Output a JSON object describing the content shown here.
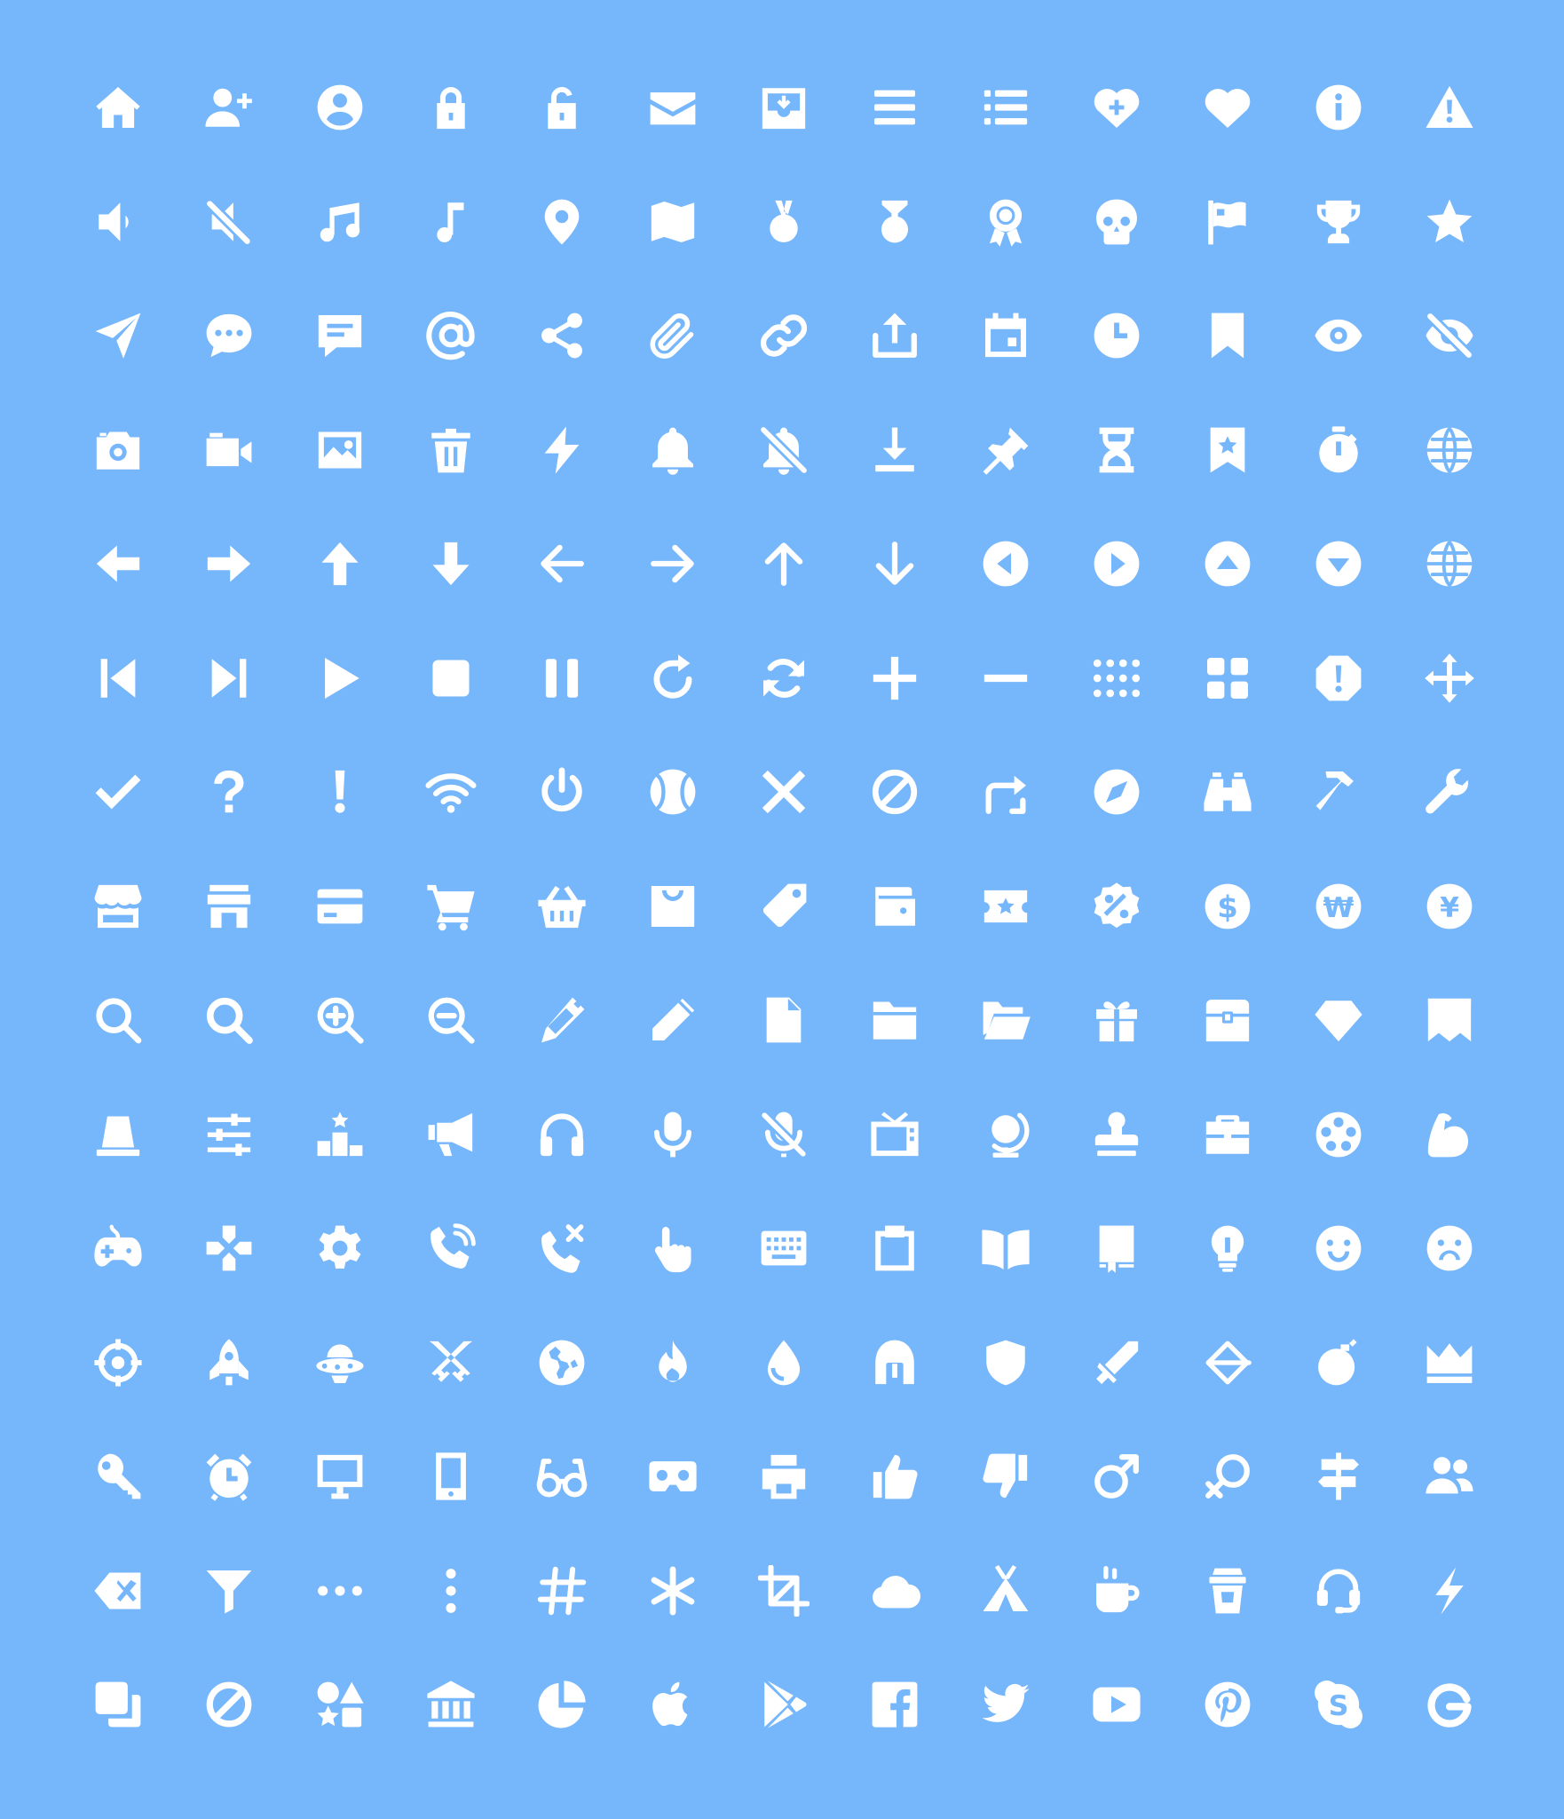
{
  "background": "#76b6fb",
  "icon_color": "#ffffff",
  "rows": [
    [
      "home-icon",
      "add-user-icon",
      "user-circle-icon",
      "lock-icon",
      "unlock-icon",
      "mail-icon",
      "inbox-icon",
      "menu-icon",
      "list-icon",
      "heart-plus-icon",
      "heart-icon",
      "info-icon",
      "warning-icon"
    ],
    [
      "volume-icon",
      "mute-icon",
      "music-notes-icon",
      "music-note-icon",
      "location-pin-icon",
      "map-icon",
      "medal-icon",
      "medal-ribbon-icon",
      "award-icon",
      "skull-icon",
      "flag-icon",
      "trophy-icon",
      "star-icon"
    ],
    [
      "send-icon",
      "chat-bubble-icon",
      "comment-icon",
      "at-icon",
      "share-icon",
      "paperclip-icon",
      "link-icon",
      "upload-icon",
      "calendar-icon",
      "clock-icon",
      "bookmark-icon",
      "eye-icon",
      "eye-off-icon"
    ],
    [
      "camera-icon",
      "video-camera-icon",
      "image-icon",
      "trash-icon",
      "lightning-icon",
      "bell-icon",
      "bell-off-icon",
      "download-icon",
      "pin-icon",
      "hourglass-icon",
      "bookmark-star-icon",
      "stopwatch-icon",
      "globe-icon"
    ],
    [
      "arrow-left-bold-icon",
      "arrow-right-bold-icon",
      "arrow-up-bold-icon",
      "arrow-down-bold-icon",
      "arrow-left-icon",
      "arrow-right-icon",
      "arrow-up-icon",
      "arrow-down-icon",
      "circle-left-icon",
      "circle-right-icon",
      "circle-up-icon",
      "circle-down-icon",
      "globe-icon"
    ],
    [
      "skip-back-icon",
      "skip-forward-icon",
      "play-icon",
      "stop-icon",
      "pause-icon",
      "refresh-icon",
      "sync-icon",
      "plus-icon",
      "minus-icon",
      "dots-grid-icon",
      "grid-icon",
      "alert-octagon-icon",
      "move-icon"
    ],
    [
      "check-icon",
      "question-icon",
      "exclamation-icon",
      "wifi-icon",
      "power-icon",
      "ball-icon",
      "close-icon",
      "block-icon",
      "repost-icon",
      "compass-icon",
      "binoculars-icon",
      "hammer-icon",
      "wrench-icon"
    ],
    [
      "store-icon",
      "shop-icon",
      "credit-card-icon",
      "cart-icon",
      "basket-icon",
      "shopping-bag-icon",
      "tag-icon",
      "wallet-icon",
      "ticket-icon",
      "discount-icon",
      "dollar-icon",
      "won-icon",
      "yen-icon"
    ],
    [
      "search-icon",
      "search-alt-icon",
      "zoom-in-icon",
      "zoom-out-icon",
      "pen-icon",
      "pencil-icon",
      "file-icon",
      "folder-icon",
      "folder-open-icon",
      "gift-icon",
      "treasure-chest-icon",
      "diamond-icon",
      "banner-icon"
    ],
    [
      "siren-icon",
      "sliders-icon",
      "podium-icon",
      "megaphone-icon",
      "headphones-icon",
      "microphone-icon",
      "microphone-off-icon",
      "tv-icon",
      "desk-globe-icon",
      "stamp-icon",
      "briefcase-icon",
      "film-reel-icon",
      "muscle-icon"
    ],
    [
      "gamepad-icon",
      "dpad-icon",
      "gear-icon",
      "phone-call-icon",
      "phone-missed-icon",
      "pointer-hand-icon",
      "keyboard-icon",
      "clipboard-icon",
      "open-book-icon",
      "book-icon",
      "lightbulb-icon",
      "smile-icon",
      "frown-icon"
    ],
    [
      "target-icon",
      "rocket-icon",
      "ufo-icon",
      "crossed-swords-icon",
      "earth-icon",
      "fire-icon",
      "water-drop-icon",
      "helmet-icon",
      "shield-icon",
      "sword-icon",
      "bow-arrow-icon",
      "bomb-icon",
      "crown-icon"
    ],
    [
      "key-icon",
      "alarm-clock-icon",
      "monitor-icon",
      "tablet-icon",
      "glasses-icon",
      "vr-headset-icon",
      "printer-icon",
      "thumbs-up-icon",
      "thumbs-down-icon",
      "male-icon",
      "female-icon",
      "signpost-icon",
      "users-icon"
    ],
    [
      "backspace-icon",
      "filter-icon",
      "more-horizontal-icon",
      "more-vertical-icon",
      "hashtag-icon",
      "asterisk-icon",
      "crop-icon",
      "cloud-icon",
      "tent-icon",
      "coffee-mug-icon",
      "coffee-cup-icon",
      "headset-icon",
      "flash-icon"
    ],
    [
      "layers-icon",
      "prohibited-icon",
      "shapes-icon",
      "bank-icon",
      "pie-chart-icon",
      "apple-icon",
      "play-store-icon",
      "facebook-icon",
      "twitter-icon",
      "youtube-icon",
      "pinterest-icon",
      "skype-icon",
      "google-icon"
    ]
  ]
}
